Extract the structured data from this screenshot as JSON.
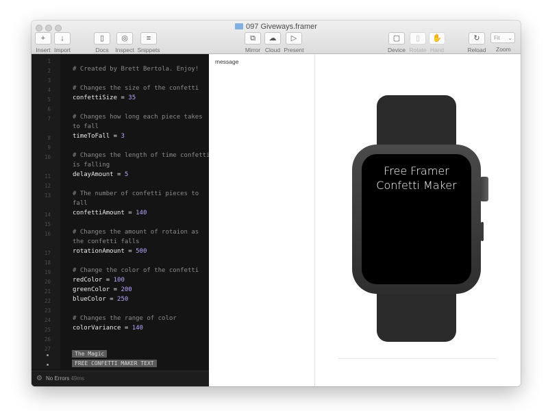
{
  "window": {
    "title": "097 Giveways.framer"
  },
  "toolbar": {
    "insert": "Insert",
    "import": "Import",
    "docs": "Docs",
    "inspect": "Inspect",
    "snippets": "Snippets",
    "mirror": "Mirror",
    "cloud": "Cloud",
    "present": "Present",
    "device": "Device",
    "rotate": "Rotate",
    "hand": "Hand",
    "reload": "Reload",
    "zoom": "Zoom",
    "zoom_value": "Fit"
  },
  "editor": {
    "line_numbers": [
      "1",
      "2",
      "3",
      "4",
      "5",
      "6",
      "7",
      "",
      "8",
      "9",
      "10",
      "",
      "11",
      "12",
      "13",
      "",
      "14",
      "15",
      "16",
      "",
      "17",
      "18",
      "19",
      "20",
      "21",
      "22",
      "23",
      "24",
      "25",
      "26",
      "27"
    ],
    "code": {
      "l2": "# Created by Brett Bertola. Enjoy!",
      "l4": "# Changes the size of the confetti",
      "l5_var": "confettiSize = ",
      "l5_val": "35",
      "l7a": "# Changes how long each piece takes",
      "l7b": "to fall",
      "l8_var": "timeToFall = ",
      "l8_val": "3",
      "l10a": "# Changes the length of time confetti",
      "l10b": "is falling",
      "l11_var": "delayAmount = ",
      "l11_val": "5",
      "l13a": "# The number of confetti pieces to",
      "l13b": "fall",
      "l14_var": "confettiAmount = ",
      "l14_val": "140",
      "l16a": "# Changes the amount of rotaion as",
      "l16b": "the confetti falls",
      "l17_var": "rotationAmount = ",
      "l17_val": "500",
      "l19": "# Change the color of the confetti",
      "l20_var": "redColor = ",
      "l20_val": "100",
      "l21_var": "greenColor = ",
      "l21_val": "200",
      "l22_var": "blueColor = ",
      "l22_val": "250",
      "l24": "# Changes the range of color",
      "l25_var": "colorVariance = ",
      "l25_val": "140"
    },
    "layer_tags": [
      "The Magic",
      "FREE CONFETTI MAKER TEXT"
    ],
    "status_text": "No Errors",
    "status_time": "49ms"
  },
  "layers_panel": {
    "item": "message"
  },
  "preview": {
    "line1": "Free Framer",
    "line2": "Confetti Maker"
  },
  "colors": {
    "editor_bg": "#141414",
    "number": "#b9a6ff",
    "comment": "#8c8c8c"
  },
  "icons": {
    "insert": "plus-icon",
    "import": "arrow-down-icon",
    "docs": "book-icon",
    "inspect": "target-icon",
    "snippets": "list-icon",
    "mirror": "mirror-icon",
    "cloud": "cloud-icon",
    "present": "play-icon",
    "device": "device-icon",
    "rotate": "rotate-icon",
    "hand": "hand-icon",
    "reload": "reload-icon"
  }
}
